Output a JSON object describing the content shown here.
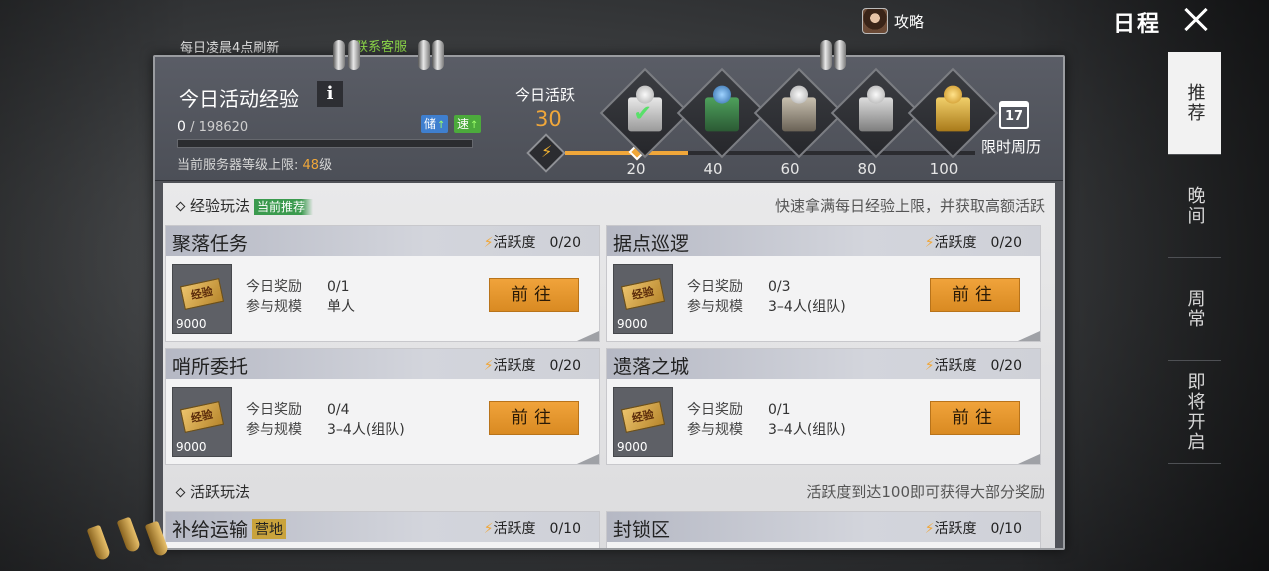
{
  "top": {
    "refresh_note": "每日凌晨4点刷新",
    "service_link": "联系客服",
    "guide_label": "攻略",
    "title": "日程"
  },
  "tabs": [
    {
      "label": "推荐",
      "active": true
    },
    {
      "label": "晚间",
      "active": false
    },
    {
      "label": "周常",
      "active": false
    },
    {
      "label": "即将开启",
      "active": false
    }
  ],
  "header": {
    "exp_title": "今日活动经验",
    "info_button": "i",
    "exp_current": "0",
    "exp_max": "/ 198620",
    "boost_store": "储",
    "boost_speed": "速",
    "server_cap_label": "当前服务器等级上限: ",
    "server_cap_level": "48",
    "server_cap_unit": "级",
    "activity_label": "今日活跃",
    "activity_value": "30",
    "activity_progress_fraction": 0.3,
    "thresholds": [
      "20",
      "40",
      "60",
      "80",
      "100"
    ],
    "calendar_day": "17",
    "calendar_label": "限时周历"
  },
  "sections": {
    "exp": {
      "title": "经验玩法",
      "badge": "当前推荐",
      "hint": "快速拿满每日经验上限，并获取高额活跃"
    },
    "active": {
      "title": "活跃玩法",
      "hint": "活跃度到达100即可获得大部分奖励"
    }
  },
  "card_labels": {
    "activity": "活跃度",
    "reward": "今日奖励",
    "scale": "参与规模",
    "go": "前往",
    "ticket_text": "经验",
    "ticket_amount": "9000"
  },
  "cards": [
    {
      "name": "聚落任务",
      "activity": "0/20",
      "reward": "0/1",
      "scale": "单人"
    },
    {
      "name": "据点巡逻",
      "activity": "0/20",
      "reward": "0/3",
      "scale": "3–4人(组队)"
    },
    {
      "name": "哨所委托",
      "activity": "0/20",
      "reward": "0/4",
      "scale": "3–4人(组队)"
    },
    {
      "name": "遗落之城",
      "activity": "0/20",
      "reward": "0/1",
      "scale": "3–4人(组队)"
    }
  ],
  "active_cards": [
    {
      "name": "补给运输",
      "badge": "营地",
      "activity": "0/10"
    },
    {
      "name": "封锁区",
      "activity": "0/10"
    }
  ],
  "colors": {
    "accent": "#f0a73a",
    "link_green": "#8fdc4a",
    "badge_green": "#3b9a4e"
  }
}
